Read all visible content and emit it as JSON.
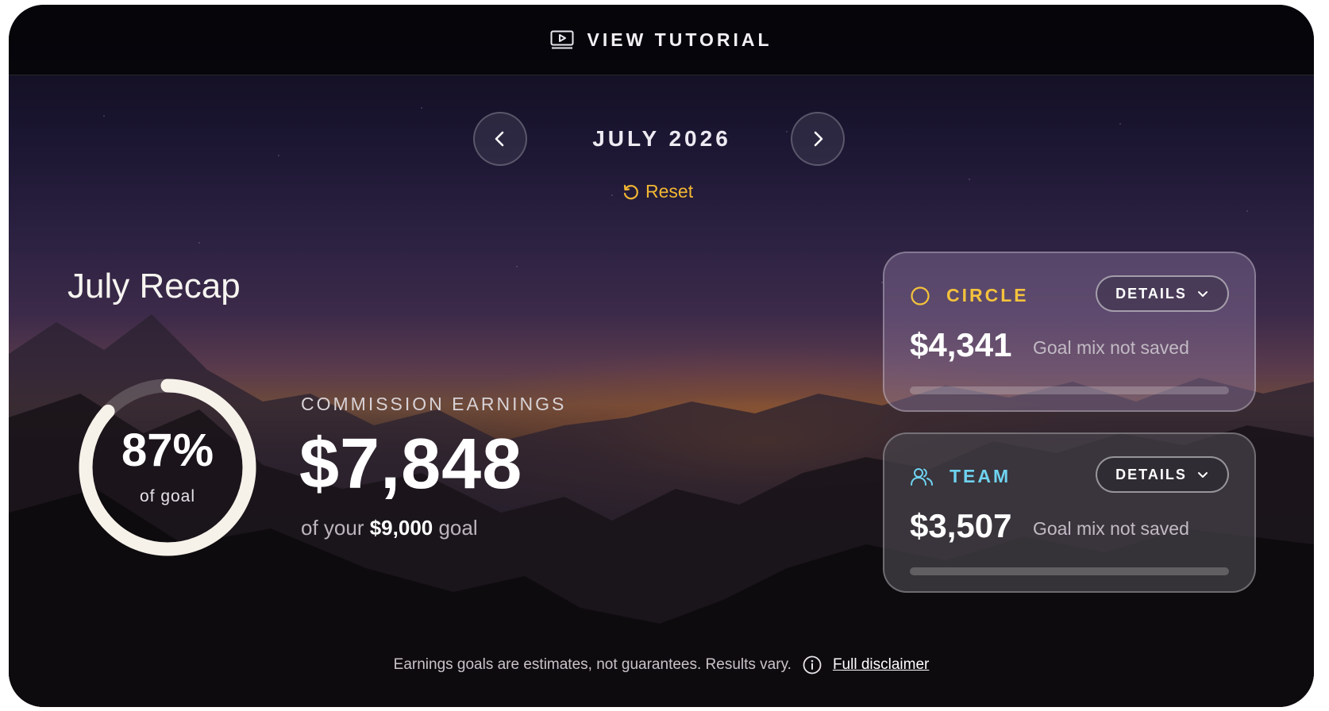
{
  "topbar": {
    "tutorial_label": "VIEW TUTORIAL",
    "icon": "video-play-icon"
  },
  "month_nav": {
    "month": "JULY 2026",
    "reset_label": "Reset"
  },
  "recap": {
    "title": "July Recap",
    "goal_percent_label": "87%",
    "goal_percent": 0.87,
    "goal_sub": "of goal",
    "earnings_label": "COMMISSION EARNINGS",
    "earnings_value": "$7,848",
    "goal_prefix": "of your ",
    "goal_amount": "$9,000",
    "goal_suffix": " goal"
  },
  "cards": [
    {
      "name": "CIRCLE",
      "icon": "circle-icon",
      "details_label": "DETAILS",
      "amount": "$4,341",
      "note": "Goal mix not saved",
      "accent": "#f4c23c",
      "progress": 0
    },
    {
      "name": "TEAM",
      "icon": "users-icon",
      "details_label": "DETAILS",
      "amount": "$3,507",
      "note": "Goal mix not saved",
      "accent": "#6fd3f0",
      "progress": 0
    }
  ],
  "footer": {
    "disclaimer": "Earnings goals are estimates, not guarantees. Results vary.",
    "link": "Full disclaimer"
  },
  "colors": {
    "reset": "#f2b733",
    "ring": "#f6f2ea"
  }
}
